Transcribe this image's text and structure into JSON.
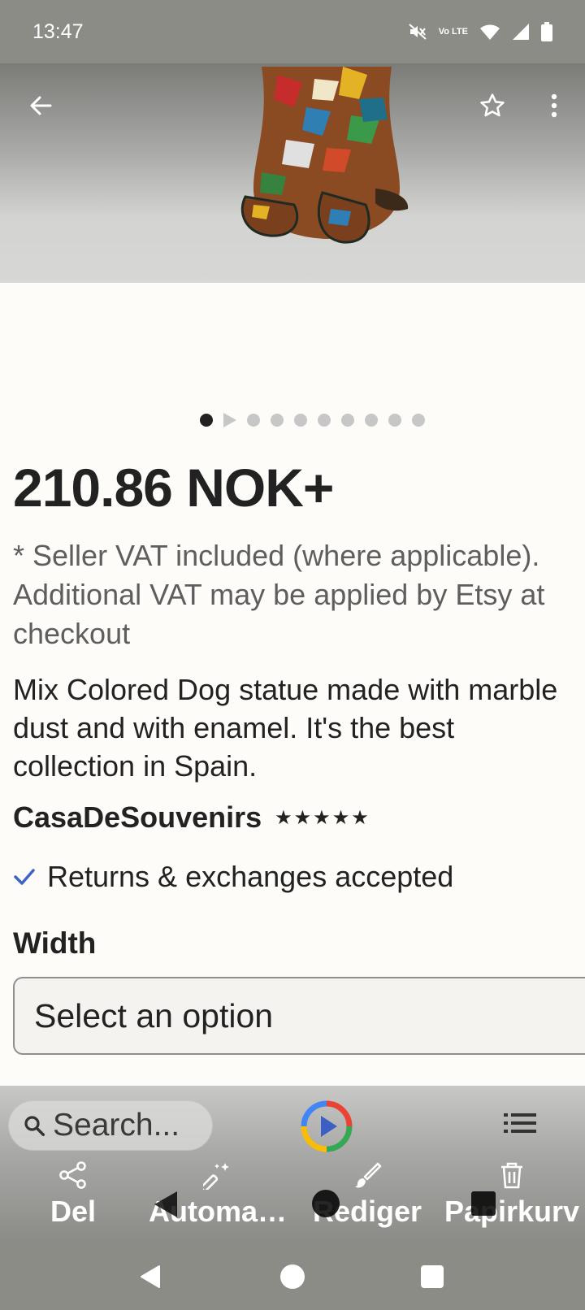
{
  "status_bar": {
    "time": "13:47",
    "network_label": "Vo LTE",
    "icons": [
      "mute-icon",
      "volte-icon",
      "wifi-icon",
      "signal-icon",
      "battery-icon"
    ]
  },
  "toolbar": {
    "icons": [
      "back-arrow-icon",
      "star-outline-icon",
      "more-vert-icon"
    ]
  },
  "carousel": {
    "slide_count": 10,
    "active_index": 0,
    "video_index": 1
  },
  "listing": {
    "price": "210.86 NOK+",
    "vat_lines": [
      "* Seller VAT included (where applicable).",
      "Additional VAT may be applied by Etsy at",
      "checkout"
    ],
    "description": "Mix Colored Dog statue made with marble dust and with enamel. It's the best collection in Spain.",
    "shop_name": "CasaDeSouvenirs",
    "rating_stars": "★★★★★",
    "rating_value": 5,
    "returns_text": "Returns & exchanges accepted",
    "width_label": "Width",
    "width_select_value": "Select an option"
  },
  "overlay": {
    "search_placeholder": "Search...",
    "actions": [
      {
        "label": "Del",
        "icon": "share-icon"
      },
      {
        "label": "Automa…",
        "icon": "magic-wand-icon"
      },
      {
        "label": "Rediger",
        "icon": "brush-icon"
      },
      {
        "label": "Papirkurv",
        "icon": "trash-icon"
      }
    ]
  },
  "colors": {
    "status_bar": "#8b8c86",
    "text_primary": "#222222",
    "text_secondary": "#5e5e5e",
    "check_blue": "#3d63c7",
    "page_background": "#fdfcf9"
  }
}
